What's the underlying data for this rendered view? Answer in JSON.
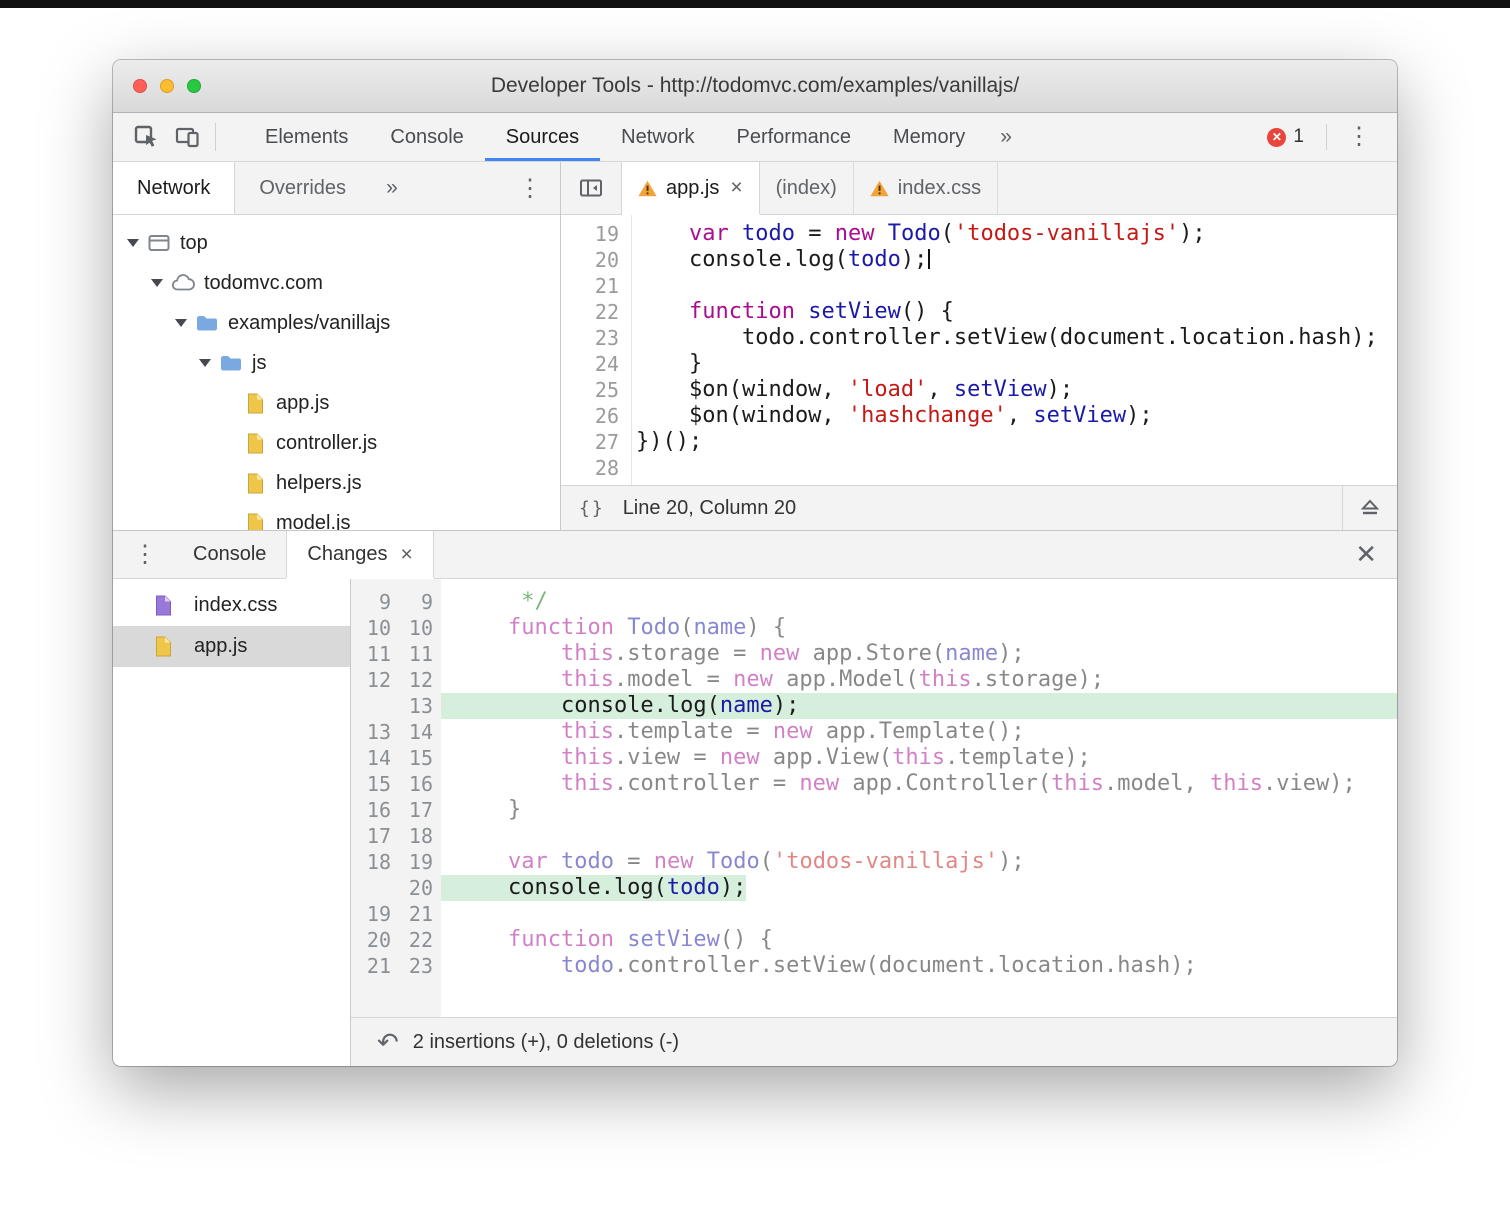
{
  "colors": {
    "accent-blue": "#4285f4",
    "error-red": "#e8453c",
    "kw": "#aa0d91",
    "ident": "#1a1aa6",
    "str": "#c41a16",
    "cmt": "#007400",
    "ins-bg": "#d6efdc",
    "folder-blue": "#7aa9e2",
    "file-yellow": "#edc64a",
    "file-purple": "#9878d8",
    "light-red": "#ff5f57",
    "light-yellow": "#febc2e",
    "light-green": "#28c840"
  },
  "icons": {
    "kebab": "⋮",
    "close": "×",
    "close_large": "✕",
    "error_x": "✕",
    "revert": "↶",
    "pretty_print": "{}"
  },
  "titlebar": {
    "title": "Developer Tools - http://todomvc.com/examples/vanillajs/"
  },
  "toolbar": {
    "tabs": [
      {
        "label": "Elements"
      },
      {
        "label": "Console"
      },
      {
        "label": "Sources"
      },
      {
        "label": "Network"
      },
      {
        "label": "Performance"
      },
      {
        "label": "Memory"
      }
    ],
    "active_tab": "Sources",
    "overflow_label": "»",
    "error_count": "1"
  },
  "sidebar": {
    "tabs": [
      {
        "label": "Network"
      },
      {
        "label": "Overrides"
      }
    ],
    "active_tab": "Network",
    "overflow_label": "»",
    "tree": [
      {
        "label": "top",
        "icon": "frame",
        "level": 0,
        "expanded": true
      },
      {
        "label": "todomvc.com",
        "icon": "cloud",
        "level": 1,
        "expanded": true
      },
      {
        "label": "examples/vanillajs",
        "icon": "folder",
        "level": 2,
        "expanded": true
      },
      {
        "label": "js",
        "icon": "folder",
        "level": 3,
        "expanded": true
      },
      {
        "label": "app.js",
        "icon": "js",
        "level": 4
      },
      {
        "label": "controller.js",
        "icon": "js",
        "level": 4
      },
      {
        "label": "helpers.js",
        "icon": "js",
        "level": 4
      },
      {
        "label": "model.js",
        "icon": "js",
        "level": 4
      }
    ]
  },
  "editor": {
    "tabs": [
      {
        "label": "app.js",
        "warning": true,
        "closable": true,
        "active": true
      },
      {
        "label": "(index)",
        "warning": false,
        "closable": false,
        "active": false
      },
      {
        "label": "index.css",
        "warning": true,
        "closable": false,
        "active": false
      }
    ],
    "lines": [
      {
        "num": "19",
        "tokens": [
          [
            "p",
            "    "
          ],
          [
            "k",
            "var"
          ],
          [
            "p",
            " "
          ],
          [
            "d",
            "todo"
          ],
          [
            "p",
            " = "
          ],
          [
            "k",
            "new"
          ],
          [
            "p",
            " "
          ],
          [
            "d",
            "Todo"
          ],
          [
            "p",
            "("
          ],
          [
            "s",
            "'todos-vanillajs'"
          ],
          [
            "p",
            ");"
          ]
        ]
      },
      {
        "num": "20",
        "caret": true,
        "tokens": [
          [
            "p",
            "    console.log("
          ],
          [
            "d",
            "todo"
          ],
          [
            "p",
            ");"
          ]
        ]
      },
      {
        "num": "21",
        "tokens": []
      },
      {
        "num": "22",
        "tokens": [
          [
            "p",
            "    "
          ],
          [
            "k",
            "function"
          ],
          [
            "p",
            " "
          ],
          [
            "d",
            "setView"
          ],
          [
            "p",
            "() {"
          ]
        ]
      },
      {
        "num": "23",
        "tokens": [
          [
            "p",
            "        todo.controller.setView(document.location.hash);"
          ]
        ]
      },
      {
        "num": "24",
        "tokens": [
          [
            "p",
            "    }"
          ]
        ]
      },
      {
        "num": "25",
        "tokens": [
          [
            "p",
            "    $on(window, "
          ],
          [
            "s",
            "'load'"
          ],
          [
            "p",
            ", "
          ],
          [
            "d",
            "setView"
          ],
          [
            "p",
            ");"
          ]
        ]
      },
      {
        "num": "26",
        "tokens": [
          [
            "p",
            "    $on(window, "
          ],
          [
            "s",
            "'hashchange'"
          ],
          [
            "p",
            ", "
          ],
          [
            "d",
            "setView"
          ],
          [
            "p",
            ");"
          ]
        ]
      },
      {
        "num": "27",
        "tokens": [
          [
            "p",
            "})();"
          ]
        ]
      },
      {
        "num": "28",
        "tokens": []
      }
    ],
    "status": {
      "line_col": "Line 20, Column 20"
    }
  },
  "drawer": {
    "tabs": [
      {
        "label": "Console",
        "active": false,
        "closable": false
      },
      {
        "label": "Changes",
        "active": true,
        "closable": true
      }
    ],
    "files": [
      {
        "label": "index.css",
        "icon": "css"
      },
      {
        "label": "app.js",
        "icon": "js",
        "selected": true
      }
    ],
    "diff": {
      "rows": [
        {
          "old": "9",
          "new": "9",
          "type": "ctx",
          "tokens": [
            [
              "c",
              "     */"
            ]
          ]
        },
        {
          "old": "10",
          "new": "10",
          "type": "ctx",
          "tokens": [
            [
              "p",
              "    "
            ],
            [
              "k",
              "function"
            ],
            [
              "p",
              " "
            ],
            [
              "d",
              "Todo"
            ],
            [
              "p",
              "("
            ],
            [
              "d",
              "name"
            ],
            [
              "p",
              ") {"
            ]
          ]
        },
        {
          "old": "11",
          "new": "11",
          "type": "ctx",
          "tokens": [
            [
              "p",
              "        "
            ],
            [
              "k",
              "this"
            ],
            [
              "p",
              ".storage = "
            ],
            [
              "k",
              "new"
            ],
            [
              "p",
              " app.Store("
            ],
            [
              "d",
              "name"
            ],
            [
              "p",
              ");"
            ]
          ]
        },
        {
          "old": "12",
          "new": "12",
          "type": "ctx",
          "tokens": [
            [
              "p",
              "        "
            ],
            [
              "k",
              "this"
            ],
            [
              "p",
              ".model = "
            ],
            [
              "k",
              "new"
            ],
            [
              "p",
              " app.Model("
            ],
            [
              "k",
              "this"
            ],
            [
              "p",
              ".storage);"
            ]
          ]
        },
        {
          "old": "",
          "new": "13",
          "type": "ins-full",
          "tokens": [
            [
              "p",
              "        console.log("
            ],
            [
              "d",
              "name"
            ],
            [
              "p",
              ");"
            ]
          ]
        },
        {
          "old": "13",
          "new": "14",
          "type": "ctx",
          "tokens": [
            [
              "p",
              "        "
            ],
            [
              "k",
              "this"
            ],
            [
              "p",
              ".template = "
            ],
            [
              "k",
              "new"
            ],
            [
              "p",
              " app.Template();"
            ]
          ]
        },
        {
          "old": "14",
          "new": "15",
          "type": "ctx",
          "tokens": [
            [
              "p",
              "        "
            ],
            [
              "k",
              "this"
            ],
            [
              "p",
              ".view = "
            ],
            [
              "k",
              "new"
            ],
            [
              "p",
              " app.View("
            ],
            [
              "k",
              "this"
            ],
            [
              "p",
              ".template);"
            ]
          ]
        },
        {
          "old": "15",
          "new": "16",
          "type": "ctx",
          "tokens": [
            [
              "p",
              "        "
            ],
            [
              "k",
              "this"
            ],
            [
              "p",
              ".controller = "
            ],
            [
              "k",
              "new"
            ],
            [
              "p",
              " app.Controller("
            ],
            [
              "k",
              "this"
            ],
            [
              "p",
              ".model, "
            ],
            [
              "k",
              "this"
            ],
            [
              "p",
              ".view);"
            ]
          ]
        },
        {
          "old": "16",
          "new": "17",
          "type": "ctx",
          "tokens": [
            [
              "p",
              "    }"
            ]
          ]
        },
        {
          "old": "17",
          "new": "18",
          "type": "ctx",
          "tokens": []
        },
        {
          "old": "18",
          "new": "19",
          "type": "ctx",
          "tokens": [
            [
              "p",
              "    "
            ],
            [
              "k",
              "var"
            ],
            [
              "p",
              " "
            ],
            [
              "d",
              "todo"
            ],
            [
              "p",
              " = "
            ],
            [
              "k",
              "new"
            ],
            [
              "p",
              " "
            ],
            [
              "d",
              "Todo"
            ],
            [
              "p",
              "("
            ],
            [
              "s",
              "'todos-vanillajs'"
            ],
            [
              "p",
              ");"
            ]
          ]
        },
        {
          "old": "",
          "new": "20",
          "type": "ins",
          "tokens": [
            [
              "p",
              "    console.log("
            ],
            [
              "d",
              "todo"
            ],
            [
              "p",
              ");"
            ]
          ]
        },
        {
          "old": "19",
          "new": "21",
          "type": "ctx",
          "tokens": []
        },
        {
          "old": "20",
          "new": "22",
          "type": "ctx",
          "tokens": [
            [
              "p",
              "    "
            ],
            [
              "k",
              "function"
            ],
            [
              "p",
              " "
            ],
            [
              "d",
              "setView"
            ],
            [
              "p",
              "() {"
            ]
          ]
        },
        {
          "old": "21",
          "new": "23",
          "type": "ctx",
          "tokens": [
            [
              "p",
              "        "
            ],
            [
              "d",
              "todo"
            ],
            [
              "p",
              ".controller.setView(document.location.hash);"
            ]
          ]
        }
      ]
    },
    "footer": {
      "summary": "2 insertions (+), 0 deletions (-)"
    }
  }
}
